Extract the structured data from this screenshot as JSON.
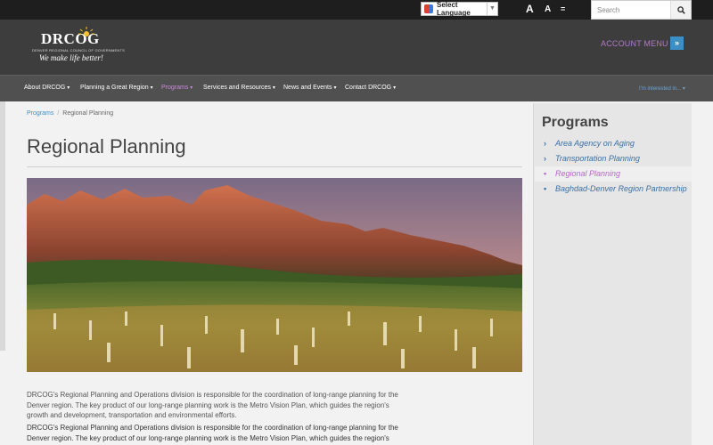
{
  "topbar": {
    "language_label": "Select Language",
    "font_size_large": "A",
    "font_size_medium": "A",
    "font_size_small": "=",
    "search_placeholder": "Search"
  },
  "header": {
    "logo_text": "DRCOG",
    "logo_subtitle": "DENVER REGIONAL COUNCIL OF GOVERNMENTS",
    "logo_tagline": "We make life better!",
    "account_menu": "ACCOUNT MENU",
    "account_button": "»"
  },
  "nav": {
    "items": [
      {
        "label": "About DRCOG"
      },
      {
        "label": "Planning a Great Region"
      },
      {
        "label": "Programs"
      },
      {
        "label": "Services and Resources"
      },
      {
        "label": "News and Events"
      },
      {
        "label": "Contact DRCOG"
      }
    ],
    "interested": "I'm interested in..."
  },
  "breadcrumb": {
    "parent": "Programs",
    "current": "Regional Planning"
  },
  "page_title": "Regional Planning",
  "paragraphs": [
    "DRCOG's Regional Planning and Operations division is responsible for the coordination of long-range planning for the Denver region. The key product of our long-range planning work is the Metro Vision Plan, which guides the region's growth and development, transportation and environmental efforts.",
    "DRCOG's Regional Planning and Operations division is responsible for the coordination of long-range planning for the Denver region. The key product of our long-range planning work is the Metro Vision Plan, which guides the region's growth and development, transportation and environmental efforts."
  ],
  "sidebar": {
    "title": "Programs",
    "items": [
      {
        "label": "Area Agency on Aging",
        "marker": "›"
      },
      {
        "label": "Transportation Planning",
        "marker": "›"
      },
      {
        "label": "Regional Planning",
        "marker": "•"
      },
      {
        "label": "Baghdad-Denver Region Partnership",
        "marker": "•"
      }
    ]
  },
  "colors": {
    "accent_purple": "#b36ac6",
    "link_blue": "#3a8fc7",
    "header_bg": "#3d3d3d",
    "nav_bg": "#505050"
  }
}
